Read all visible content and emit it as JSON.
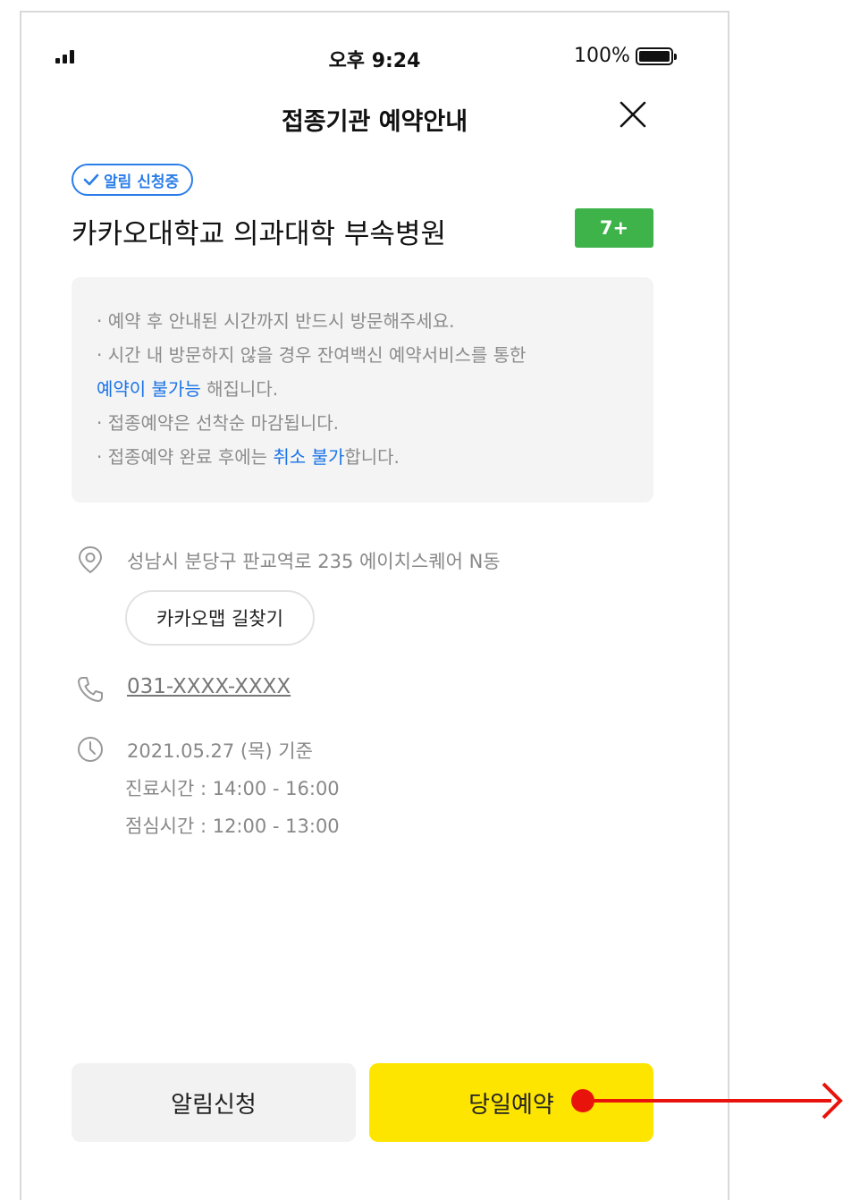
{
  "status_bar": {
    "time": "오후 9:24",
    "battery": "100%"
  },
  "header": {
    "title": "접종기관 예약안내"
  },
  "badge": {
    "label": "알림 신청중"
  },
  "hospital": {
    "name": "카카오대학교 의과대학 부속병원",
    "age_label": "7+"
  },
  "notice": {
    "line1": "· 예약 후 안내된 시간까지 반드시 방문해주세요.",
    "line2": "· 시간 내 방문하지 않을 경우 잔여백신 예약서비스를 통한",
    "line3_highlight": "예약이 불가능",
    "line3_rest": " 해집니다.",
    "line4": "· 접종예약은 선착순 마감됩니다.",
    "line5_pre": "· 접종예약 완료 후에는 ",
    "line5_highlight": "취소 불가",
    "line5_post": "합니다."
  },
  "location": {
    "address": "성남시 분당구 판교역로 235 에이치스퀘어 N동",
    "map_button": "카카오맵 길찾기"
  },
  "contact": {
    "phone": "031-XXXX-XXXX"
  },
  "hours": {
    "date": "2021.05.27 (목) 기준",
    "clinic": "진료시간 : 14:00 - 16:00",
    "lunch": "점심시간 : 12:00 - 13:00"
  },
  "actions": {
    "notify": "알림신청",
    "reserve": "당일예약"
  },
  "colors": {
    "accent_blue": "#2b7de9",
    "age_green": "#3db34a",
    "reserve_yellow": "#fee500",
    "annotation_red": "#e8140c"
  }
}
